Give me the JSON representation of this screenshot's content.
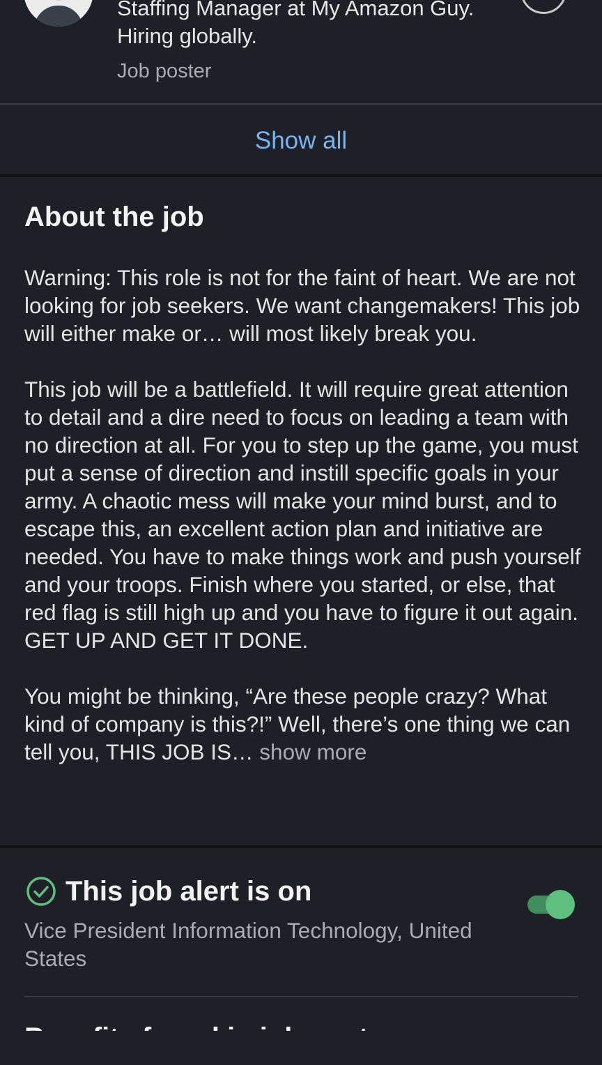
{
  "poster": {
    "headline": "Staffing Manager at My Amazon Guy. Hiring globally.",
    "role": "Job poster"
  },
  "show_all_label": "Show all",
  "about": {
    "title": "About the job",
    "paragraphs": [
      "Warning: This role is not for the faint of heart. We are not looking for job seekers. We want changemakers! This job will either make or… will most likely break you.",
      "This job will be a battlefield. It will require great attention to detail and a dire need to focus on leading a team with no direction at all. For you to step up the game, you must put a sense of direction and instill specific goals in your army. A chaotic mess will make your mind burst, and to escape this, an excellent action plan and initiative are needed. You have to make things work and push yourself and your troops. Finish where you started, or else, that red flag is still high up and you have to figure it out again. GET UP AND GET IT DONE.",
      "You might be thinking, “Are these people crazy? What kind of company is this?!” Well, there’s one thing we can tell you, THIS JOB IS…"
    ],
    "show_more_label": "show more"
  },
  "alert": {
    "title": "This job alert is on",
    "subtitle": "Vice President Information Technology, United States",
    "toggle_on": true
  },
  "benefits": {
    "title": "Benefits found in job post"
  },
  "colors": {
    "background": "#1d2026",
    "link": "#79b3f0",
    "toggle": "#5fbf7f",
    "check": "#5fbf7f",
    "secondary_text": "#a9acb1"
  },
  "icons": {
    "avatar": "profile-photo",
    "send": "send-icon",
    "check": "check-circle-icon"
  }
}
